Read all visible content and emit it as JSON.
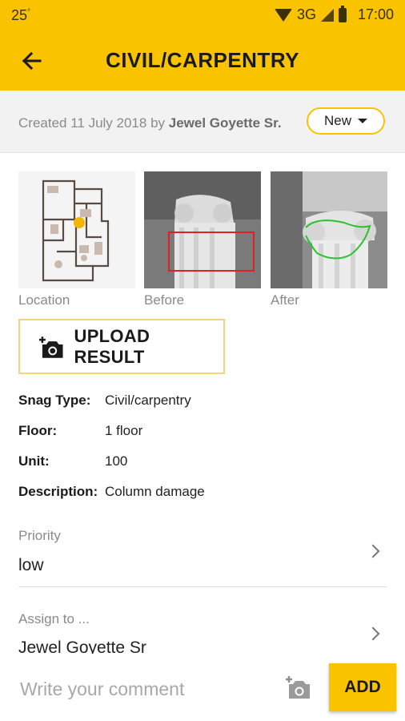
{
  "status_bar": {
    "temp": "25",
    "temp_unit": "°",
    "network": "3G",
    "time": "17:00"
  },
  "app_bar": {
    "title": "CIVIL/CARPENTRY"
  },
  "meta": {
    "created_prefix": "Created 11 July 2018 by ",
    "created_by": "Jewel Goyette Sr.",
    "status": "New"
  },
  "images": [
    {
      "label": "Location"
    },
    {
      "label": "Before"
    },
    {
      "label": "After"
    }
  ],
  "upload": {
    "label": "UPLOAD RESULT"
  },
  "details": [
    {
      "key": "Snag Type:",
      "value": "Civil/carpentry"
    },
    {
      "key": "Floor:",
      "value": "1 floor"
    },
    {
      "key": "Unit:",
      "value": "100"
    },
    {
      "key": "Description:",
      "value": "Column damage"
    }
  ],
  "priority": {
    "label": "Priority",
    "value": "low"
  },
  "assign": {
    "label": "Assign to ...",
    "value": "Jewel Goyette Sr"
  },
  "comment": {
    "placeholder": "Write your comment",
    "add_label": "ADD"
  },
  "colors": {
    "accent": "#f9c300",
    "border": "#f5d37a"
  }
}
